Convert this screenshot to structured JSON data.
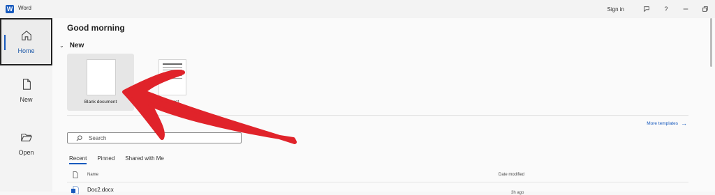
{
  "titlebar": {
    "app_logo": "W",
    "app_name": "Word",
    "sign_in": "Sign in",
    "icons": [
      "feedback-icon",
      "help-icon",
      "minimize-icon",
      "restore-icon"
    ],
    "help": "?"
  },
  "nav": {
    "items": [
      {
        "label": "Home",
        "icon": "home-icon",
        "active": true
      },
      {
        "label": "New",
        "icon": "new-document-icon",
        "active": false
      },
      {
        "label": "Open",
        "icon": "folder-open-icon",
        "active": false
      }
    ]
  },
  "main": {
    "greeting": "Good morning",
    "new_section": {
      "chevron": "⌄",
      "label": "New",
      "templates": [
        {
          "label": "Blank document"
        },
        {
          "label": "…ost"
        }
      ],
      "more_templates": "More templates",
      "more_arrow": "→"
    },
    "search": {
      "placeholder": "Search",
      "value": ""
    },
    "tabs": [
      {
        "label": "Recent",
        "active": true
      },
      {
        "label": "Pinned",
        "active": false
      },
      {
        "label": "Shared with Me",
        "active": false
      }
    ],
    "file_list": {
      "columns": {
        "name": "Name",
        "date_modified": "Date modified"
      },
      "rows": [
        {
          "name": "Doc2.docx",
          "modified": "3h ago"
        }
      ]
    }
  },
  "colors": {
    "accent": "#185abd",
    "annotation_arrow": "#e0232a"
  }
}
